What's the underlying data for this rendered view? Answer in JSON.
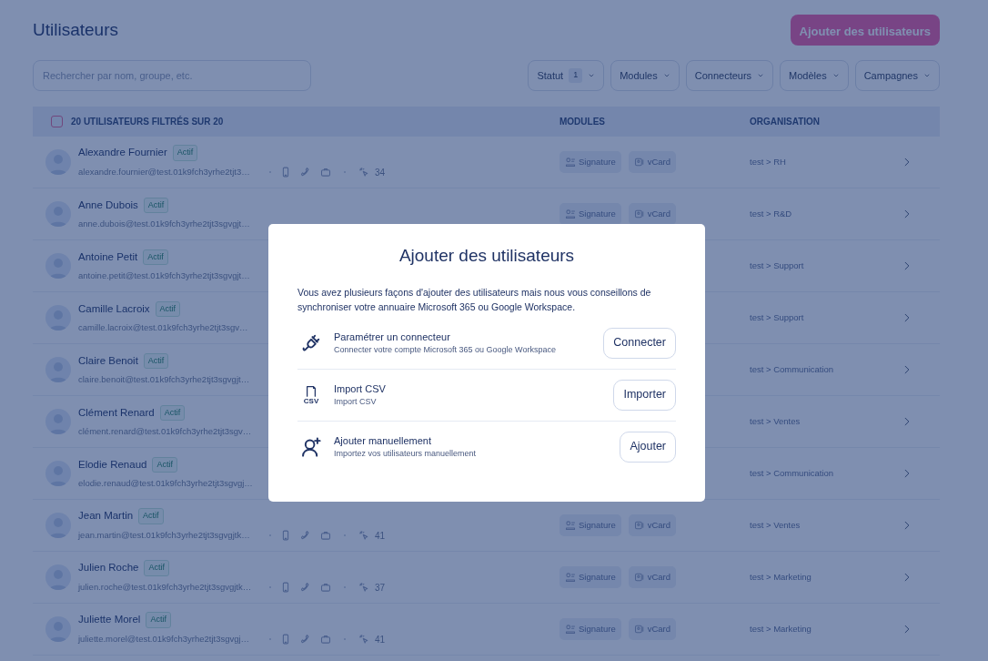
{
  "page": {
    "title": "Utilisateurs",
    "add_button": "Ajouter des utilisateurs"
  },
  "search": {
    "placeholder": "Rechercher par nom, groupe, etc."
  },
  "filters": [
    {
      "label": "Statut",
      "count": "1"
    },
    {
      "label": "Modules"
    },
    {
      "label": "Connecteurs"
    },
    {
      "label": "Modèles"
    },
    {
      "label": "Campagnes"
    }
  ],
  "table": {
    "select_all": {
      "checked": false
    },
    "columns": [
      "20 UTILISATEURS FILTRÉS SUR 20",
      "MODULES",
      "ORGANISATION"
    ],
    "rows": [
      {
        "name": "Alexandre Fournier",
        "status": "Actif",
        "email": "alexandre.fournier@test.01k9fch3yrhe2tjt3…",
        "count": "34",
        "modules": [
          "Signature",
          "vCard"
        ],
        "organisation": "test > RH"
      },
      {
        "name": "Anne Dubois",
        "status": "Actif",
        "email": "anne.dubois@test.01k9fch3yrhe2tjt3sgvgjt…",
        "modules": [
          "Signature",
          "vCard"
        ],
        "organisation": "test > R&D"
      },
      {
        "name": "Antoine Petit",
        "status": "Actif",
        "email": "antoine.petit@test.01k9fch3yrhe2tjt3sgvgjt…",
        "organisation": "test > Support"
      },
      {
        "name": "Camille Lacroix",
        "status": "Actif",
        "email": "camille.lacroix@test.01k9fch3yrhe2tjt3sgv…",
        "organisation": "test > Support"
      },
      {
        "name": "Claire Benoit",
        "status": "Actif",
        "email": "claire.benoit@test.01k9fch3yrhe2tjt3sgvgjt…",
        "organisation": "test > Communication"
      },
      {
        "name": "Clément Renard",
        "status": "Actif",
        "email": "clément.renard@test.01k9fch3yrhe2tjt3sgv…",
        "organisation": "test > Ventes"
      },
      {
        "name": "Elodie Renaud",
        "status": "Actif",
        "email": "elodie.renaud@test.01k9fch3yrhe2tjt3sgvgj…",
        "organisation": "test > Communication"
      },
      {
        "name": "Jean Martin",
        "status": "Actif",
        "email": "jean.martin@test.01k9fch3yrhe2tjt3sgvgjtk…",
        "count": "41",
        "modules": [
          "Signature",
          "vCard"
        ],
        "organisation": "test > Ventes"
      },
      {
        "name": "Julien Roche",
        "status": "Actif",
        "email": "julien.roche@test.01k9fch3yrhe2tjt3sgvgjtk…",
        "count": "37",
        "modules": [
          "Signature",
          "vCard"
        ],
        "organisation": "test > Marketing"
      },
      {
        "name": "Juliette Morel",
        "status": "Actif",
        "email": "juliette.morel@test.01k9fch3yrhe2tjt3sgvgj…",
        "count": "41",
        "modules": [
          "Signature",
          "vCard"
        ],
        "organisation": "test > Marketing"
      }
    ]
  },
  "modal": {
    "title": "Ajouter des utilisateurs",
    "intro": "Vous avez plusieurs façons d'ajouter des utilisateurs mais nous vous conseillons de synchroniser votre annuaire Microsoft 365 ou Google Workspace.",
    "options": [
      {
        "kind": "connector",
        "title": "Paramétrer un connecteur",
        "subtitle": "Connecter votre compte Microsoft 365 ou Google Workspace",
        "button": "Connecter"
      },
      {
        "kind": "csv",
        "icon_text": "CSV",
        "title": "Import CSV",
        "subtitle": "Import CSV",
        "button": "Importer"
      },
      {
        "kind": "manual",
        "title": "Ajouter manuellement",
        "subtitle": "Importez vos utilisateurs manuellement",
        "button": "Ajouter"
      }
    ]
  }
}
